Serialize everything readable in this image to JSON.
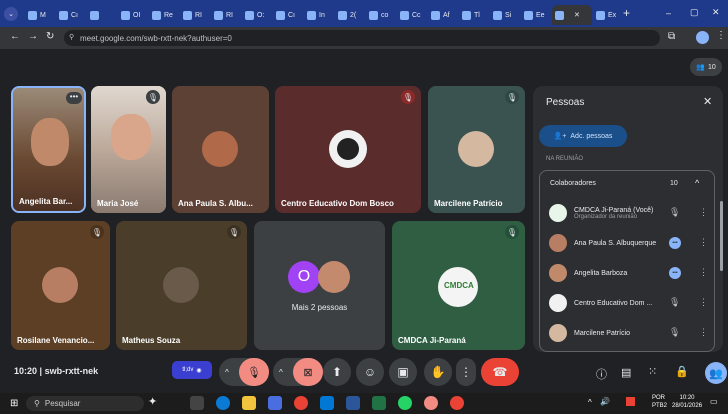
{
  "browser": {
    "tabs": [
      "M",
      "Cı",
      "",
      "OI",
      "Re",
      "RI",
      "RI",
      "O:",
      "Cı",
      "In",
      "2(",
      "co",
      "Cc",
      "Af",
      "Tl",
      "Si",
      "Ee",
      "",
      "Ex"
    ],
    "url": "meet.google.com/swb-rxtt-nek?authuser=0",
    "plus": "+",
    "window_controls": {
      "min": "–",
      "max": "▢",
      "close": "✕"
    }
  },
  "meet": {
    "participant_count": "10",
    "tiles": [
      {
        "name": "Angelita Bar...",
        "type": "video"
      },
      {
        "name": "Maria José",
        "type": "video"
      },
      {
        "name": "Ana Paula S. Albu...",
        "type": "avatar"
      },
      {
        "name": "Centro Educativo Dom Bosco",
        "type": "avatar"
      },
      {
        "name": "Marcilene Patrício",
        "type": "avatar"
      },
      {
        "name": "Rosilane Venancio...",
        "type": "avatar"
      },
      {
        "name": "Matheus Souza",
        "type": "avatar"
      },
      {
        "name": "Mais 2 pessoas",
        "type": "more",
        "initial": "O"
      },
      {
        "name": "CMDCA Ji-Paraná",
        "type": "avatar"
      }
    ],
    "bottom": {
      "time": "10:20",
      "meeting_code": "swb-rxtt-nek",
      "badge": "tl;dv"
    }
  },
  "panel": {
    "title": "Pessoas",
    "add_button": "Adc. pessoas",
    "section": "NA REUNIÃO",
    "group_label": "Colaboradores",
    "group_count": "10",
    "people": [
      {
        "name": "CMDCA Ji-Paraná (Você)",
        "sub": "Organizador da reunião"
      },
      {
        "name": "Ana Paula S. Albuquerque",
        "sub": ""
      },
      {
        "name": "Angelita Barboza",
        "sub": ""
      },
      {
        "name": "Centro Educativo Dom ...",
        "sub": ""
      },
      {
        "name": "Marcilene Patrício",
        "sub": ""
      }
    ]
  },
  "taskbar": {
    "search_placeholder": "Pesquisar",
    "lang": "POR",
    "lang2": "PTB2",
    "clock_time": "10:20",
    "clock_date": "28/01/2026"
  }
}
